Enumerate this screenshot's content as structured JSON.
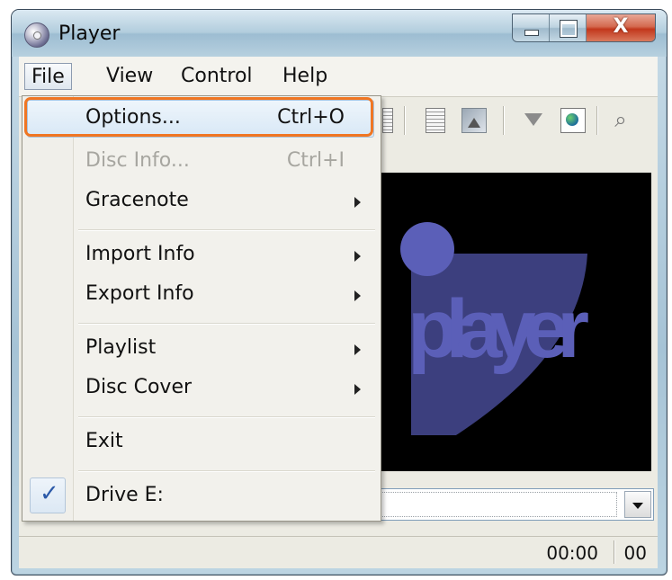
{
  "window": {
    "title": "Player",
    "app_icon": "cd-disc-icon",
    "close_glyph": "X"
  },
  "menubar": {
    "items": [
      {
        "label": "File",
        "mnemonic": "F"
      },
      {
        "label": "View",
        "mnemonic": "V"
      },
      {
        "label": "Control",
        "mnemonic": "C"
      },
      {
        "label": "Help",
        "mnemonic": "H"
      }
    ],
    "active_item": "File"
  },
  "file_menu": {
    "items": [
      {
        "label": "Options...",
        "shortcut": "Ctrl+O",
        "enabled": true,
        "highlighted": true
      },
      {
        "label": "Disc Info...",
        "shortcut": "Ctrl+I",
        "enabled": false
      },
      {
        "label": "Gracenote",
        "submenu": true
      },
      {
        "label": "Import Info",
        "submenu": true
      },
      {
        "label": "Export Info",
        "submenu": true
      },
      {
        "label": "Playlist",
        "submenu": true
      },
      {
        "label": "Disc Cover",
        "submenu": true
      },
      {
        "label": "Exit"
      },
      {
        "label": "Drive E:",
        "checked": true
      }
    ],
    "check_glyph": "✓"
  },
  "toolbar": {
    "icons": [
      "cd-drive-icon",
      "document-icon",
      "image-icon",
      "eject-arrow-icon",
      "globe-icon",
      "search-icon"
    ]
  },
  "display": {
    "logo_text": "player",
    "background_color": "#000000",
    "logo_color": "#5b5fb8"
  },
  "status": {
    "time": "00:00",
    "track": "00"
  },
  "colors": {
    "highlight_outline": "#f07623",
    "check_color": "#2b59a8"
  }
}
